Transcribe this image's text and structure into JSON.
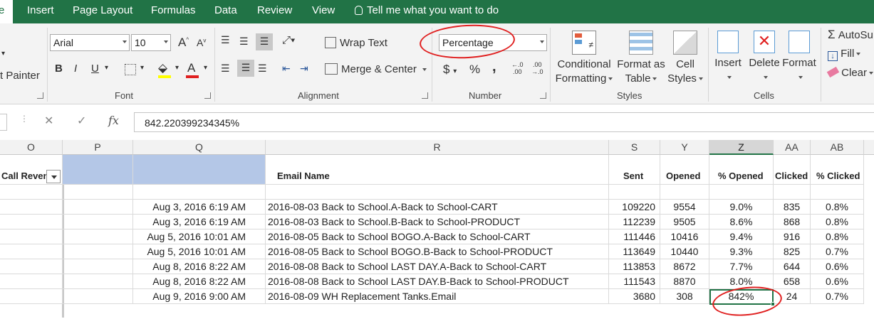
{
  "menu": {
    "file": "e",
    "tabs": [
      "Insert",
      "Page Layout",
      "Formulas",
      "Data",
      "Review",
      "View"
    ],
    "tell_me": "Tell me what you want to do"
  },
  "ribbon": {
    "clipboard": {
      "format_painter": "t Painter"
    },
    "font": {
      "name": "Arial",
      "size": "10",
      "label": "Font",
      "bold": "B",
      "italic": "I",
      "underline": "U",
      "grow": "A",
      "shrink": "A"
    },
    "alignment": {
      "wrap_text": "Wrap Text",
      "merge_center": "Merge & Center",
      "label": "Alignment"
    },
    "number": {
      "format": "Percentage",
      "label": "Number",
      "currency": "$",
      "percent": "%",
      "comma": ","
    },
    "styles": {
      "conditional": "Conditional",
      "formatting": "Formatting",
      "format_as": "Format as",
      "table": "Table",
      "cell": "Cell",
      "cell_styles": "Styles",
      "label": "Styles"
    },
    "cells": {
      "insert": "Insert",
      "delete": "Delete",
      "format": "Format",
      "label": "Cells"
    },
    "editing": {
      "autosum": "AutoSu",
      "fill": "Fill",
      "clear": "Clear"
    }
  },
  "formula_bar": {
    "fx": "fx",
    "value": "842.220399234345%"
  },
  "columns": [
    "O",
    "P",
    "Q",
    "R",
    "S",
    "Y",
    "Z",
    "AA",
    "AB"
  ],
  "headers": {
    "O": "Call Revenu",
    "R": "Email Name",
    "S": "Sent",
    "Y": "Opened",
    "Z": "% Opened",
    "AA": "Clicked",
    "AB": "% Clicked"
  },
  "rows": [
    {
      "q": "Aug 3, 2016 6:19 AM",
      "r": "2016-08-03 Back to School.A-Back to School-CART",
      "s": "109220",
      "y": "9554",
      "z": "9.0%",
      "aa": "835",
      "ab": "0.8%"
    },
    {
      "q": "Aug 3, 2016 6:19 AM",
      "r": "2016-08-03 Back to School.B-Back to School-PRODUCT",
      "s": "112239",
      "y": "9505",
      "z": "8.6%",
      "aa": "868",
      "ab": "0.8%"
    },
    {
      "q": "Aug 5, 2016 10:01 AM",
      "r": "2016-08-05 Back to School BOGO.A-Back to School-CART",
      "s": "111446",
      "y": "10416",
      "z": "9.4%",
      "aa": "916",
      "ab": "0.8%"
    },
    {
      "q": "Aug 5, 2016 10:01 AM",
      "r": "2016-08-05 Back to School BOGO.B-Back to School-PRODUCT",
      "s": "113649",
      "y": "10440",
      "z": "9.3%",
      "aa": "825",
      "ab": "0.7%"
    },
    {
      "q": "Aug 8, 2016 8:22 AM",
      "r": "2016-08-08 Back to School LAST DAY.A-Back to School-CART",
      "s": "113853",
      "y": "8672",
      "z": "7.7%",
      "aa": "644",
      "ab": "0.6%"
    },
    {
      "q": "Aug 8, 2016 8:22 AM",
      "r": "2016-08-08 Back to School LAST DAY.B-Back to School-PRODUCT",
      "s": "111543",
      "y": "8870",
      "z": "8.0%",
      "aa": "658",
      "ab": "0.6%"
    },
    {
      "q": "Aug 9, 2016 9:00 AM",
      "r": "2016-08-09 WH Replacement Tanks.Email",
      "s": "3680",
      "y": "308",
      "z": "842%",
      "aa": "24",
      "ab": "0.7%"
    }
  ],
  "colors": {
    "accent": "#217346",
    "annotation": "#e02020",
    "header_fill": "#b4c7e7"
  }
}
